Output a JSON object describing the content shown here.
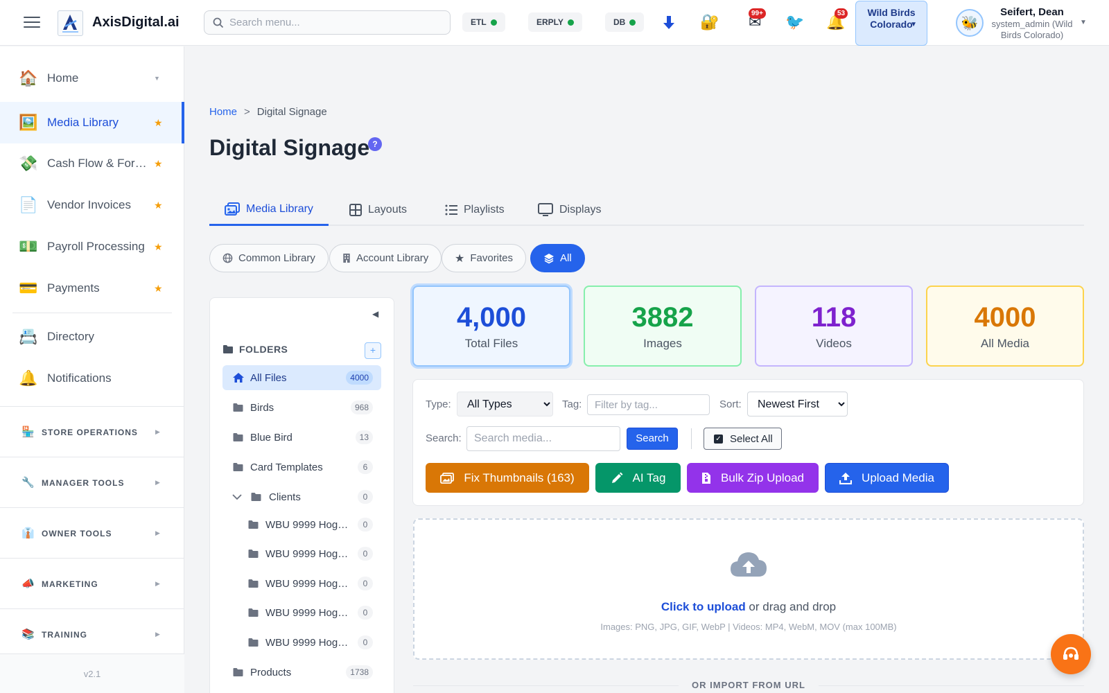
{
  "header": {
    "brand": "AxisDigital.ai",
    "search_placeholder": "Search menu...",
    "status": [
      {
        "label": "ETL",
        "color": "#16a34a"
      },
      {
        "label": "ERPLY",
        "color": "#16a34a"
      },
      {
        "label": "DB",
        "color": "#16a34a"
      }
    ],
    "mail_badge": "99+",
    "bell_badge": "53",
    "location": "Wild Birds Colorado",
    "user_name": "Seifert, Dean",
    "user_role": "system_admin (Wild Birds Colorado)"
  },
  "sidebar": {
    "items": [
      {
        "label": "Home",
        "icon": "home-icon"
      },
      {
        "label": "Media Library",
        "icon": "picture-icon"
      },
      {
        "label": "Cash Flow & For…",
        "icon": "money-wings-icon"
      },
      {
        "label": "Vendor Invoices",
        "icon": "document-icon"
      },
      {
        "label": "Payroll Processing",
        "icon": "dollar-bill-icon"
      },
      {
        "label": "Payments",
        "icon": "credit-card-icon"
      },
      {
        "label": "Directory",
        "icon": "card-index-icon"
      },
      {
        "label": "Notifications",
        "icon": "bell-icon"
      }
    ],
    "sections": [
      {
        "label": "STORE OPERATIONS",
        "icon": "store-icon"
      },
      {
        "label": "MANAGER TOOLS",
        "icon": "wrench-icon"
      },
      {
        "label": "OWNER TOOLS",
        "icon": "necktie-icon"
      },
      {
        "label": "MARKETING",
        "icon": "megaphone-icon"
      },
      {
        "label": "TRAINING",
        "icon": "books-icon"
      }
    ],
    "version": "v2.1"
  },
  "breadcrumb": {
    "home": "Home",
    "separator": ">",
    "current": "Digital Signage"
  },
  "page_title": "Digital Signage",
  "help_label": "?",
  "tabs": [
    {
      "label": "Media Library",
      "icon": "media-icon"
    },
    {
      "label": "Layouts",
      "icon": "grid-icon"
    },
    {
      "label": "Playlists",
      "icon": "list-icon"
    },
    {
      "label": "Displays",
      "icon": "monitor-icon"
    }
  ],
  "chips": [
    {
      "label": "Common Library",
      "icon": "globe-icon"
    },
    {
      "label": "Account Library",
      "icon": "building-icon"
    },
    {
      "label": "Favorites",
      "icon": "star-icon"
    },
    {
      "label": "All",
      "icon": "layers-icon"
    }
  ],
  "folders": {
    "title": "FOLDERS",
    "add_label": "+",
    "items": [
      {
        "name": "All Files",
        "count": "4000"
      },
      {
        "name": "Birds",
        "count": "968"
      },
      {
        "name": "Blue Bird",
        "count": "13"
      },
      {
        "name": "Card Templates",
        "count": "6"
      },
      {
        "name": "Clients",
        "count": "0"
      },
      {
        "name": "WBU 9999 Hog…",
        "count": "0"
      },
      {
        "name": "WBU 9999 Hog…",
        "count": "0"
      },
      {
        "name": "WBU 9999 Hog…",
        "count": "0"
      },
      {
        "name": "WBU 9999 Hog…",
        "count": "0"
      },
      {
        "name": "WBU 9999 Hog…",
        "count": "0"
      },
      {
        "name": "Products",
        "count": "1738"
      }
    ]
  },
  "stats": {
    "total": {
      "value": "4,000",
      "label": "Total Files"
    },
    "images": {
      "value": "3882",
      "label": "Images"
    },
    "videos": {
      "value": "118",
      "label": "Videos"
    },
    "media": {
      "value": "4000",
      "label": "All Media"
    }
  },
  "filters": {
    "type_label": "Type:",
    "type_value": "All Types",
    "tag_label": "Tag:",
    "tag_placeholder": "Filter by tag...",
    "sort_label": "Sort:",
    "sort_value": "Newest First",
    "search_label": "Search:",
    "search_placeholder": "Search media...",
    "search_button": "Search",
    "select_all": "Select All"
  },
  "actions": {
    "fix_thumbnails": "Fix Thumbnails (163)",
    "ai_tag": "AI Tag",
    "bulk_zip": "Bulk Zip Upload",
    "upload_media": "Upload Media"
  },
  "dropzone": {
    "link": "Click to upload",
    "text": " or drag and drop",
    "formats": "Images: PNG, JPG, GIF, WebP | Videos: MP4, WebM, MOV (max 100MB)"
  },
  "import_divider": "OR IMPORT FROM URL"
}
